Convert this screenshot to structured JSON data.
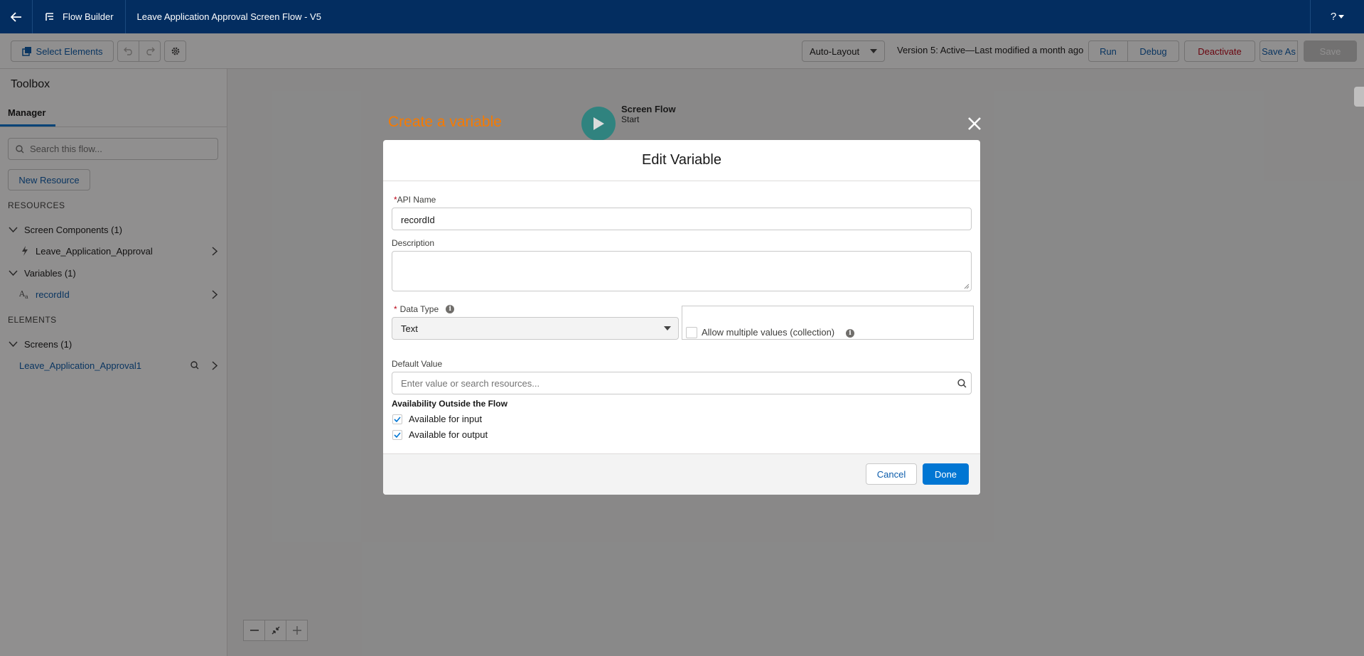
{
  "topnav": {
    "brand": "Flow Builder",
    "flow_name": "Leave Application Approval Screen Flow - V5",
    "help": "?"
  },
  "toolbar": {
    "select_elements": "Select Elements",
    "auto_layout": "Auto-Layout",
    "version_text": "Version 5: Active—Last modified a month ago",
    "run": "Run",
    "debug": "Debug",
    "deactivate": "Deactivate",
    "save_as": "Save As",
    "save": "Save"
  },
  "sidebar": {
    "title": "Toolbox",
    "tab": "Manager",
    "search_placeholder": "Search this flow...",
    "new_resource": "New Resource",
    "resources_heading": "RESOURCES",
    "screen_components": "Screen Components (1)",
    "screen_component_item": "Leave_Application_Approval",
    "variables": "Variables (1)",
    "variable_item": "recordId",
    "elements_heading": "ELEMENTS",
    "screens": "Screens (1)",
    "screen_item": "Leave_Application_Approval1"
  },
  "canvas": {
    "start_title": "Screen Flow",
    "start_sub": "Start",
    "annotation": "Create a variable"
  },
  "modal": {
    "title": "Edit Variable",
    "api_name_label": "API Name",
    "api_name_value": "recordId",
    "description_label": "Description",
    "data_type_label": "Data Type",
    "data_type_value": "Text",
    "allow_multiple": "Allow multiple values (collection)",
    "default_value_label": "Default Value",
    "default_value_placeholder": "Enter value or search resources...",
    "availability_heading": "Availability Outside the Flow",
    "available_input": "Available for input",
    "available_output": "Available for output",
    "cancel": "Cancel",
    "done": "Done"
  },
  "colors": {
    "nav": "#032d60",
    "brand_blue": "#0176d3",
    "annotation_orange": "#f77a00",
    "deactivate_red": "#ba0517",
    "start_node": "#0b827c"
  }
}
